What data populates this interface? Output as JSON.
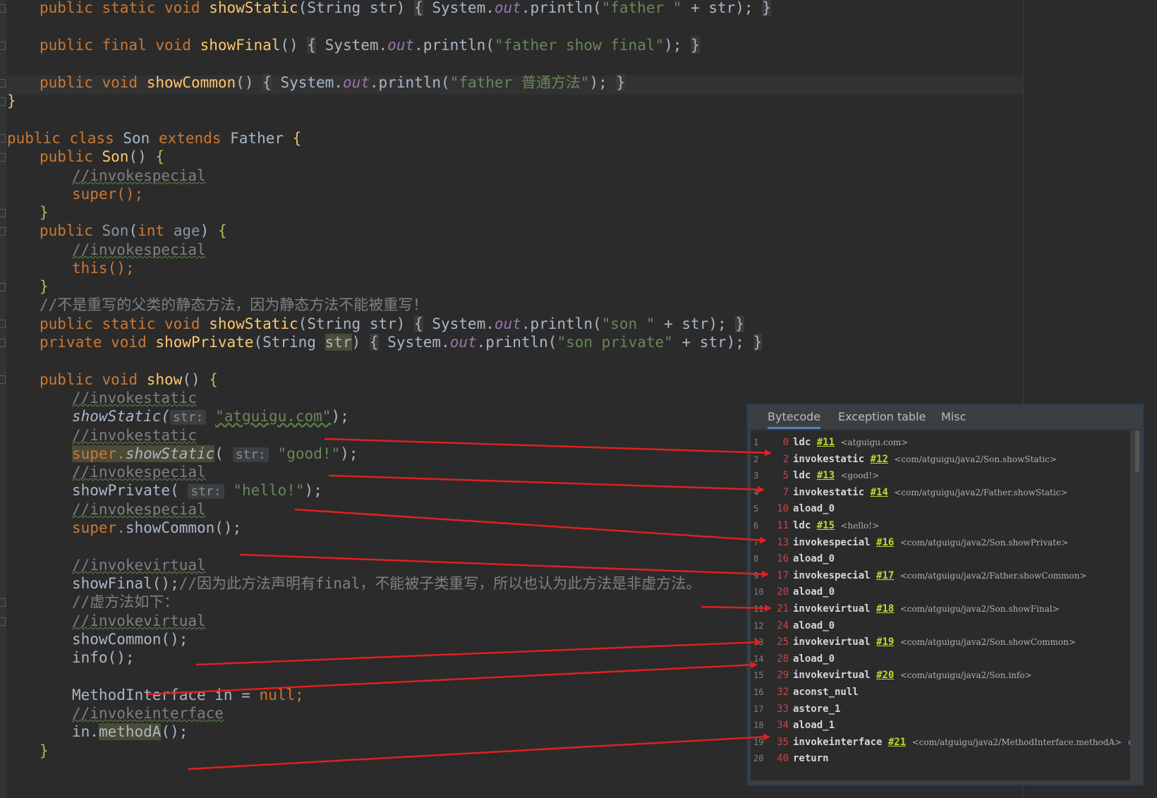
{
  "code": {
    "father": {
      "show_static": {
        "mods": "public static void",
        "name": "showStatic",
        "params": "(String str)",
        "body_pre": "System.",
        "out": "out",
        "call": ".println(",
        "arg": "\"father \"",
        "rest": " + str);"
      },
      "show_final": {
        "mods": "public final void",
        "name": "showFinal",
        "params": "()",
        "body_pre": "System.",
        "out": "out",
        "call": ".println(",
        "arg": "\"father show final\"",
        "rest": ");"
      },
      "show_common": {
        "mods": "public void",
        "name": "showCommon",
        "params": "()",
        "body_pre": "System.",
        "out": "out",
        "call": ".println(",
        "arg": "\"father 普通方法\"",
        "rest": ");"
      },
      "close": "}"
    },
    "son": {
      "class_decl": {
        "kw1": "public class",
        "name": "Son",
        "kw2": "extends",
        "parent": "Father",
        "open": "{"
      },
      "ctor1": {
        "mods": "public",
        "name": "Son",
        "params": "()",
        "open": "{",
        "comment": "//invokespecial",
        "body": "super();",
        "close": "}"
      },
      "ctor2": {
        "mods": "public",
        "name": "Son",
        "params_open": "(",
        "param_type": "int",
        "param_name": "age",
        "params_close": ")",
        "open": "{",
        "comment": "//invokespecial",
        "body": "this();",
        "close": "}"
      },
      "static_comment": "//不是重写的父类的静态方法，因为静态方法不能被重写！",
      "show_static": {
        "mods": "public static void",
        "name": "showStatic",
        "params": "(String str)",
        "body_pre": "System.",
        "out": "out",
        "call": ".println(",
        "arg": "\"son \"",
        "rest": " + str);"
      },
      "show_private": {
        "mods": "private void",
        "name": "showPrivate",
        "p_open": "(String ",
        "p_name": "str",
        "p_close": ")",
        "body_pre": "System.",
        "out": "out",
        "call": ".println(",
        "arg": "\"son private\"",
        "rest": " + str);"
      },
      "show": {
        "decl": {
          "mods": "public void",
          "name": "show",
          "params": "()",
          "open": "{"
        },
        "c1": "//invokestatic",
        "l1": {
          "call": "showStatic(",
          "hint": "str:",
          "arg": "\"atguigu.com\"",
          "end": ");"
        },
        "c2": "//invokestatic",
        "l2": {
          "sup": "super.",
          "call": "showStatic",
          "open": "(",
          "hint": "str:",
          "arg": "\"good!\"",
          "end": ");"
        },
        "c3": "//invokespecial",
        "l3": {
          "call": "showPrivate(",
          "hint": "str:",
          "arg": "\"hello!\"",
          "end": ");"
        },
        "c4": "//invokespecial",
        "l4": {
          "sup": "super.",
          "call": "showCommon();"
        },
        "c5": "//invokevirtual",
        "l5": {
          "call": "showFinal();",
          "comment": "//因为此方法声明有final，不能被子类重写，所以也认为此方法是非虚方法。"
        },
        "c6": "//虚方法如下：",
        "c7": "//invokevirtual",
        "l6": {
          "call": "showCommon();"
        },
        "l7": {
          "call": "info();"
        },
        "l8": {
          "type": "MethodInterface in = ",
          "val": "null",
          "end": ";"
        },
        "c8": "//invokeinterface",
        "l9": {
          "pre": "in.",
          "call": "methodA",
          "end": "();"
        },
        "close": "}"
      }
    }
  },
  "popup": {
    "tabs": [
      "Bytecode",
      "Exception table",
      "Misc"
    ],
    "active_tab": "Bytecode",
    "rows": [
      {
        "ln": "1",
        "off": "0",
        "op": "ldc",
        "ref": "#11",
        "cmt": "<atguigu.com>"
      },
      {
        "ln": "2",
        "off": "2",
        "op": "invokestatic",
        "ref": "#12",
        "cmt": "<com/atguigu/java2/Son.showStatic>"
      },
      {
        "ln": "3",
        "off": "5",
        "op": "ldc",
        "ref": "#13",
        "cmt": "<good!>"
      },
      {
        "ln": "4",
        "off": "7",
        "op": "invokestatic",
        "ref": "#14",
        "cmt": "<com/atguigu/java2/Father.showStatic>"
      },
      {
        "ln": "5",
        "off": "10",
        "op": "aload_0",
        "ref": "",
        "cmt": ""
      },
      {
        "ln": "6",
        "off": "11",
        "op": "ldc",
        "ref": "#15",
        "cmt": "<hello!>"
      },
      {
        "ln": "7",
        "off": "13",
        "op": "invokespecial",
        "ref": "#16",
        "cmt": "<com/atguigu/java2/Son.showPrivate>"
      },
      {
        "ln": "8",
        "off": "16",
        "op": "aload_0",
        "ref": "",
        "cmt": ""
      },
      {
        "ln": "9",
        "off": "17",
        "op": "invokespecial",
        "ref": "#17",
        "cmt": "<com/atguigu/java2/Father.showCommon>"
      },
      {
        "ln": "10",
        "off": "20",
        "op": "aload_0",
        "ref": "",
        "cmt": ""
      },
      {
        "ln": "11",
        "off": "21",
        "op": "invokevirtual",
        "ref": "#18",
        "cmt": "<com/atguigu/java2/Son.showFinal>"
      },
      {
        "ln": "12",
        "off": "24",
        "op": "aload_0",
        "ref": "",
        "cmt": ""
      },
      {
        "ln": "13",
        "off": "25",
        "op": "invokevirtual",
        "ref": "#19",
        "cmt": "<com/atguigu/java2/Son.showCommon>"
      },
      {
        "ln": "14",
        "off": "28",
        "op": "aload_0",
        "ref": "",
        "cmt": ""
      },
      {
        "ln": "15",
        "off": "29",
        "op": "invokevirtual",
        "ref": "#20",
        "cmt": "<com/atguigu/java2/Son.info>"
      },
      {
        "ln": "16",
        "off": "32",
        "op": "aconst_null",
        "ref": "",
        "cmt": ""
      },
      {
        "ln": "17",
        "off": "33",
        "op": "astore_1",
        "ref": "",
        "cmt": ""
      },
      {
        "ln": "18",
        "off": "34",
        "op": "aload_1",
        "ref": "",
        "cmt": ""
      },
      {
        "ln": "19",
        "off": "35",
        "op": "invokeinterface",
        "ref": "#21",
        "cmt": "<com/atguigu/java2/MethodInterface.methodA>",
        "extra": "cou"
      },
      {
        "ln": "20",
        "off": "40",
        "op": "return",
        "ref": "",
        "cmt": ""
      }
    ]
  },
  "colors": {
    "keyword": "#cc7832",
    "method": "#ffc66d",
    "string": "#6a8759",
    "comment": "#808080",
    "arrow": "#e02020",
    "ref": "#c0d930"
  }
}
